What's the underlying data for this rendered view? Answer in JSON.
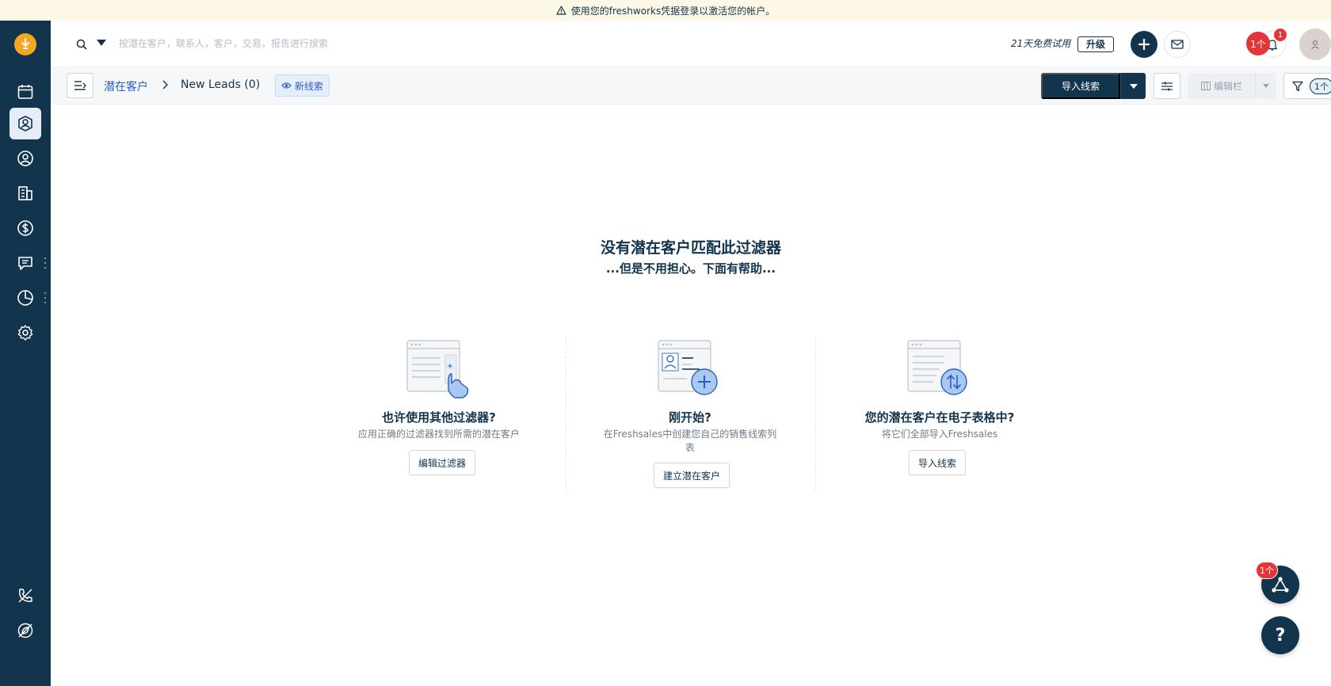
{
  "banner": {
    "text": "使用您的freshworks凭据登录以激活您的帐户。"
  },
  "sidebar": {
    "items": [
      {
        "icon": "calendar-icon",
        "active": false
      },
      {
        "icon": "leads-icon",
        "active": true
      },
      {
        "icon": "contact-icon",
        "active": false
      },
      {
        "icon": "accounts-icon",
        "active": false
      },
      {
        "icon": "deals-icon",
        "active": false
      },
      {
        "icon": "conversations-icon",
        "active": false
      },
      {
        "icon": "reports-icon",
        "active": false
      },
      {
        "icon": "settings-icon",
        "active": false
      },
      {
        "icon": "phone-icon",
        "active": false
      },
      {
        "icon": "leaf-icon",
        "active": false
      }
    ]
  },
  "search": {
    "placeholder": "按潜在客户，联系人，客户，交易，报告进行搜索"
  },
  "topbar": {
    "trial_text": "21天免费试用",
    "upgrade_label": "升级",
    "notification_count": "1",
    "red_badge": "1个"
  },
  "subbar": {
    "breadcrumb_root": "潜在客户",
    "breadcrumb_current": "New Leads (0)",
    "view_label": "新线索",
    "import_label": "导入线索",
    "edit_columns_label": "编辑栏",
    "filter_count": "1个"
  },
  "empty_state": {
    "title": "没有潜在客户匹配此过滤器",
    "subtitle": "...但是不用担心。下面有帮助..."
  },
  "cards": [
    {
      "title": "也许使用其他过滤器?",
      "desc": "应用正确的过滤器找到所需的潜在客户",
      "button": "编辑过滤器"
    },
    {
      "title": "刚开始?",
      "desc": "在Freshsales中创建您自己的销售线索列表",
      "button": "建立潜在客户"
    },
    {
      "title": "您的潜在客户在电子表格中?",
      "desc": "将它们全部导入Freshsales",
      "button": "导入线索"
    }
  ],
  "fab": {
    "badge": "1个",
    "help": "?"
  },
  "colors": {
    "sidebar": "#13344d",
    "accent": "#2c5cc5",
    "badge": "#e43538",
    "banner": "#fdf8e6",
    "logo": "#f5a623"
  }
}
